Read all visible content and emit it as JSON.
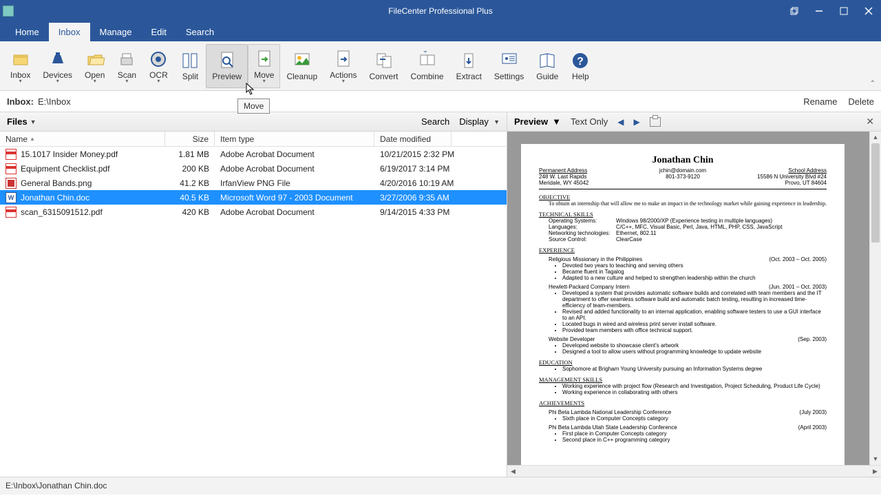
{
  "app": {
    "title": "FileCenter Professional Plus"
  },
  "tabs": [
    "Home",
    "Inbox",
    "Manage",
    "Edit",
    "Search"
  ],
  "active_tab": 1,
  "ribbon": [
    {
      "label": "Inbox",
      "dd": true
    },
    {
      "label": "Devices",
      "dd": true
    },
    {
      "label": "Open",
      "dd": true
    },
    {
      "label": "Scan",
      "dd": true
    },
    {
      "label": "OCR",
      "dd": true
    },
    {
      "label": "Split"
    },
    {
      "label": "Preview",
      "active": true
    },
    {
      "label": "Move",
      "hover": true,
      "dd": true
    },
    {
      "label": "Cleanup"
    },
    {
      "label": "Actions",
      "dd": true
    },
    {
      "label": "Convert"
    },
    {
      "label": "Combine"
    },
    {
      "label": "Extract"
    },
    {
      "label": "Settings"
    },
    {
      "label": "Guide"
    },
    {
      "label": "Help"
    }
  ],
  "tooltip": "Move",
  "pathbar": {
    "label": "Inbox:",
    "path": "E:\\Inbox",
    "rename": "Rename",
    "delete": "Delete"
  },
  "files_header": {
    "title": "Files",
    "search": "Search",
    "display": "Display"
  },
  "columns": {
    "name": "Name",
    "size": "Size",
    "type": "Item type",
    "date": "Date modified"
  },
  "files": [
    {
      "icon": "pdf",
      "name": "15.1017 Insider Money.pdf",
      "size": "1.81 MB",
      "type": "Adobe Acrobat Document",
      "date": "10/21/2015 2:32 PM"
    },
    {
      "icon": "pdf",
      "name": "Equipment Checklist.pdf",
      "size": "200 KB",
      "type": "Adobe Acrobat Document",
      "date": "6/19/2017 3:14 PM"
    },
    {
      "icon": "png",
      "name": "General Bands.png",
      "size": "41.2 KB",
      "type": "IrfanView PNG File",
      "date": "4/20/2016 10:19 AM"
    },
    {
      "icon": "doc",
      "name": "Jonathan Chin.doc",
      "size": "40.5 KB",
      "type": "Microsoft Word 97 - 2003 Document",
      "date": "3/27/2006 9:35 AM",
      "selected": true
    },
    {
      "icon": "pdf",
      "name": "scan_6315091512.pdf",
      "size": "420 KB",
      "type": "Adobe Acrobat Document",
      "date": "9/14/2015 4:33 PM"
    }
  ],
  "preview_header": {
    "title": "Preview",
    "textonly": "Text Only"
  },
  "preview_doc": {
    "name": "Jonathan Chin",
    "email": "jchin@domain.com",
    "phone": "801-373-9120",
    "perm_addr": {
      "h": "Permanent Address",
      "l1": "248 W. Last Rapids",
      "l2": "Meridale, WY 45042"
    },
    "school_addr": {
      "h": "School Address",
      "l1": "15586 N University Blvd #24",
      "l2": "Provo, UT 84604"
    },
    "objective_h": "OBJECTIVE",
    "objective": "To obtain an internship that will allow me to make an impact in the technology market while gaining experience in leadership.",
    "tech_h": "TECHNICAL SKILLS",
    "tech": [
      {
        "k": "Operating Systems:",
        "v": "Windows 98/2000/XP (Experience testing in multiple languages)"
      },
      {
        "k": "Languages:",
        "v": "C/C++, MFC, Visual Basic, Perl, Java, HTML, PHP, CSS, JavaScript"
      },
      {
        "k": "Networking technologies:",
        "v": "Ethernet, 802.11"
      },
      {
        "k": "Source Control:",
        "v": "ClearCase"
      }
    ],
    "exp_h": "EXPERIENCE",
    "jobs": [
      {
        "t": "Religious Missionary in the Philippines",
        "d": "(Oct. 2003 – Oct. 2005)",
        "b": [
          "Devoted two years to teaching and serving others",
          "Became fluent in Tagalog",
          "Adapted to a new culture and helped to strengthen leadership within the church"
        ]
      },
      {
        "t": "Hewlett-Packard Company Intern",
        "d": "(Jun. 2001 – Oct. 2003)",
        "b": [
          "Developed a system that provides automatic software builds and correlated with team members and the IT department to offer seamless software build and automatic batch testing, resulting in increased time-efficiency of team-members.",
          "Revised and added functionality to an internal application, enabling software testers to use a GUI interface to an API.",
          "Located bugs in wired and wireless print server install software.",
          "Provided team members with office technical support."
        ]
      },
      {
        "t": "Website Developer",
        "d": "(Sep. 2003)",
        "b": [
          "Developed website to showcase client's artwork",
          "Designed a tool to allow users without programming knowledge to update website"
        ]
      }
    ],
    "edu_h": "EDUCATION",
    "edu": "Sophomore at Brigham Young University pursuing an Information Systems degree",
    "mgmt_h": "MANAGEMENT SKILLS",
    "mgmt": [
      "Working experience with project flow (Research and Investigation, Project Scheduling, Product Life Cycle)",
      "Working experience in collaborating with others"
    ],
    "ach_h": "ACHIEVEMENTS",
    "ach": [
      {
        "t": "Phi Beta Lambda National Leadership Conference",
        "d": "(July 2003)",
        "b": [
          "Sixth place in Computer Concepts category"
        ]
      },
      {
        "t": "Phi Beta Lambda Utah State Leadership Conference",
        "d": "(April 2003)",
        "b": [
          "First place in Computer Concepts category",
          "Second place in C++ programming category"
        ]
      }
    ]
  },
  "statusbar": "E:\\Inbox\\Jonathan Chin.doc"
}
